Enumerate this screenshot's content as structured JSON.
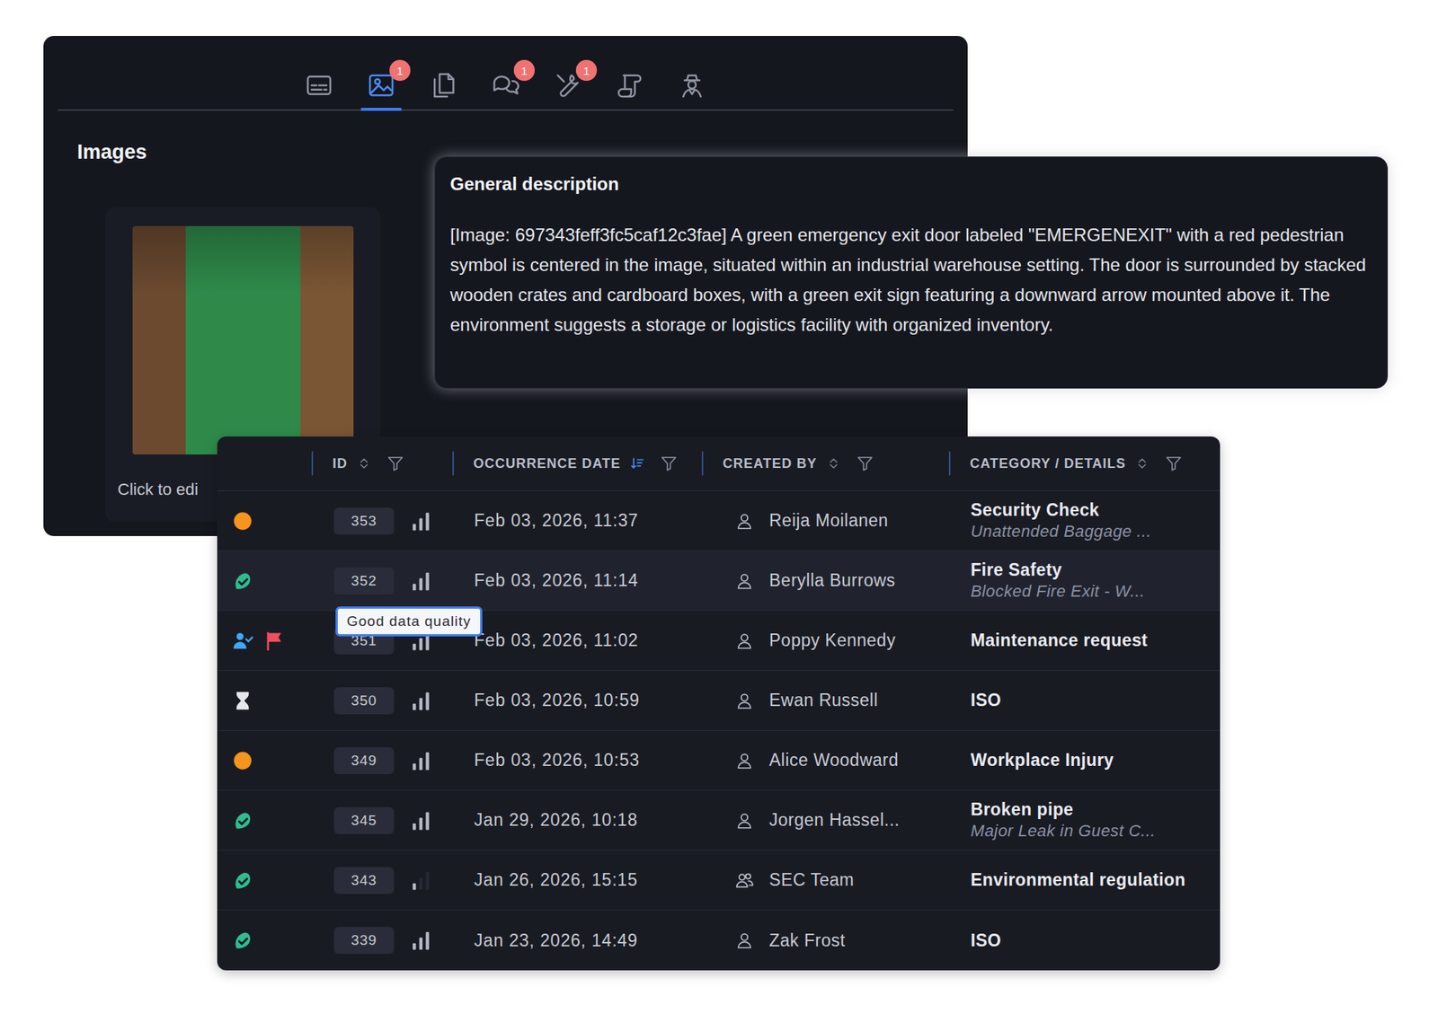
{
  "panel": {
    "tabs": [
      {
        "kind": "subtitles",
        "selected": false,
        "badge": ""
      },
      {
        "kind": "images",
        "selected": true,
        "badge": "1"
      },
      {
        "kind": "documents",
        "selected": false,
        "badge": ""
      },
      {
        "kind": "comments",
        "selected": false,
        "badge": "1"
      },
      {
        "kind": "tools",
        "selected": false,
        "badge": "1"
      },
      {
        "kind": "scroll",
        "selected": false,
        "badge": ""
      },
      {
        "kind": "agent",
        "selected": false,
        "badge": ""
      }
    ],
    "section_title": "Images",
    "image_caption": "Click to edi"
  },
  "description": {
    "title": "General description",
    "text": "[Image: 697343feff3fc5caf12c3fae] A green emergency exit door labeled \"EMERGENEXIT\" with a red pedestrian symbol is centered in the image, situated within an industrial warehouse setting. The door is surrounded by stacked wooden crates and cardboard boxes, with a green exit sign featuring a downward arrow mounted above it. The environment suggests a storage or logistics facility with organized inventory."
  },
  "table": {
    "columns": [
      {
        "label": "ID",
        "sort": "none"
      },
      {
        "label": "OCCURRENCE DATE",
        "sort": "descending"
      },
      {
        "label": "CREATED BY",
        "sort": "none"
      },
      {
        "label": "CATEGORY / DETAILS",
        "sort": "none"
      }
    ],
    "rows": [
      {
        "id": "353",
        "selected": false,
        "level": 1,
        "status": [
          {
            "kind": "dot",
            "color": "#f7941d"
          }
        ],
        "date": "Feb 03, 2026, 11:37",
        "creator_kind": "person",
        "created_by": "Reija Moilanen",
        "category": "Security Check",
        "details": "Unattended Baggage ..."
      },
      {
        "id": "352",
        "selected": true,
        "level": 1,
        "status": [
          {
            "kind": "resolved",
            "color": "#2ebd8f"
          }
        ],
        "date": "Feb 03, 2026, 11:14",
        "creator_kind": "person",
        "created_by": "Berylla Burrows",
        "category": "Fire Safety",
        "details": "Blocked Fire Exit - W..."
      },
      {
        "id": "351",
        "selected": false,
        "level": 1,
        "status": [
          {
            "kind": "assigned",
            "color": "#3fa9f5"
          },
          {
            "kind": "flag",
            "color": "#f04e5e"
          }
        ],
        "date": "Feb 03, 2026, 11:02",
        "creator_kind": "person",
        "created_by": "Poppy Kennedy",
        "category": "Maintenance request",
        "details": ""
      },
      {
        "id": "350",
        "selected": false,
        "level": 1,
        "status": [
          {
            "kind": "hourglass",
            "color": "#e6e7ea"
          }
        ],
        "date": "Feb 03, 2026, 10:59",
        "creator_kind": "person",
        "created_by": "Ewan Russell",
        "category": "ISO",
        "details": ""
      },
      {
        "id": "349",
        "selected": false,
        "level": 1,
        "status": [
          {
            "kind": "dot",
            "color": "#f7941d"
          }
        ],
        "date": "Feb 03, 2026, 10:53",
        "creator_kind": "person",
        "created_by": "Alice Woodward",
        "category": "Workplace Injury",
        "details": ""
      },
      {
        "id": "345",
        "selected": false,
        "level": 1,
        "status": [
          {
            "kind": "resolved",
            "color": "#2ebd8f"
          }
        ],
        "date": "Jan 29, 2026, 10:18",
        "creator_kind": "person",
        "created_by": "Jorgen Hassel...",
        "category": "Broken pipe",
        "details": "Major Leak in Guest C..."
      },
      {
        "id": "343",
        "selected": false,
        "level": 0.33,
        "status": [
          {
            "kind": "resolved",
            "color": "#2ebd8f"
          }
        ],
        "date": "Jan 26, 2026, 15:15",
        "creator_kind": "team",
        "created_by": "SEC Team",
        "category": "Environmental regulation",
        "details": ""
      },
      {
        "id": "339",
        "selected": false,
        "level": 1,
        "status": [
          {
            "kind": "resolved",
            "color": "#2ebd8f"
          }
        ],
        "date": "Jan 23, 2026, 14:49",
        "creator_kind": "person",
        "created_by": "Zak Frost",
        "category": "ISO",
        "details": ""
      }
    ],
    "tooltip": {
      "text": "Good data quality",
      "row": "352"
    }
  }
}
